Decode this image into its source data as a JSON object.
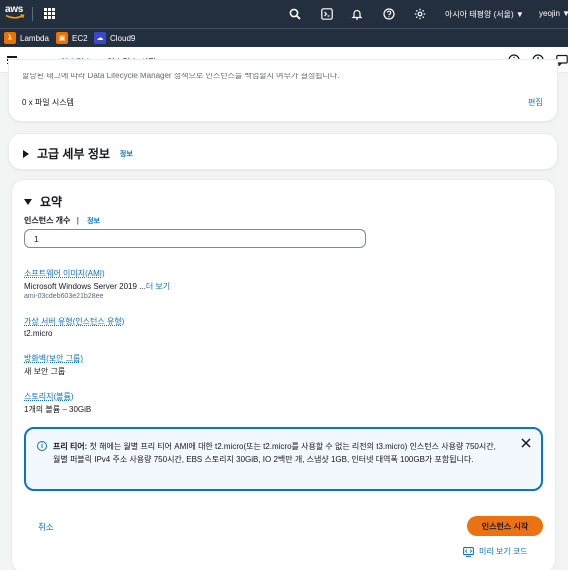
{
  "topnav": {
    "logo": "aws",
    "region": "아시아 태평양 (서울) ▼",
    "user": "yeojin ▼",
    "icons": [
      "apps-grid-icon",
      "search-icon",
      "cloudshell-icon",
      "bell-icon",
      "help-icon",
      "settings-icon"
    ]
  },
  "favorites": [
    {
      "label": "Lambda",
      "color": "#ed7100",
      "icon": "lambda-icon"
    },
    {
      "label": "EC2",
      "color": "#ed7100",
      "icon": "ec2-icon"
    },
    {
      "label": "Cloud9",
      "color": "#3b48cc",
      "icon": "cloud9-icon"
    }
  ],
  "breadcrumb": {
    "items": [
      "EC2",
      "인스턴스"
    ],
    "current": "인스턴스 시작"
  },
  "storage_card": {
    "cut_text": "할당된 태그에 따라 Data Lifecycle Manager 정책으로 인스턴스를 백업할지 여부가 결정됩니다.",
    "file_systems": "0 x 파일 시스템",
    "edit": "편집"
  },
  "advanced": {
    "title": "고급 세부 정보",
    "info": "정보"
  },
  "summary": {
    "title": "요약",
    "instance_count_label": "인스턴스 개수",
    "info": "정보",
    "instance_count_value": "1",
    "ami_label": "소프트웨어 이미지(AMI)",
    "ami_value": "Microsoft Windows Server 2019 ...",
    "ami_more": "더 보기",
    "ami_id": "ami-03cdeb603e21b28ee",
    "type_label": "가상 서버 유형(인스턴스 유형)",
    "type_value": "t2.micro",
    "firewall_label": "방화벽(보안 그룹)",
    "firewall_value": "새 보안 그룹",
    "storage_label": "스토리지(볼륨)",
    "storage_value": "1개의 볼륨 – 30GiB",
    "alert_title": "프리 티어:",
    "alert_body": " 첫 해에는 월별 프리 티어 AMI에 대한 t2.micro(또는 t2.micro를 사용할 수 없는 리전의 t3.micro) 인스턴스 사용량 750시간, 월별 퍼블릭 IPv4 주소 사용량 750시간, EBS 스토리지 30GiB, IO 2백만 개, 스냅샷 1GB, 인터넷 대역폭 100GB가 포함됩니다.",
    "cancel": "취소",
    "launch": "인스턴스 시작",
    "preview": "미리 보기 코드"
  },
  "colors": {
    "nav": "#232f3e",
    "link": "#0972d3",
    "primary": "#ec7211",
    "alert_bg": "#f2f8fd"
  }
}
